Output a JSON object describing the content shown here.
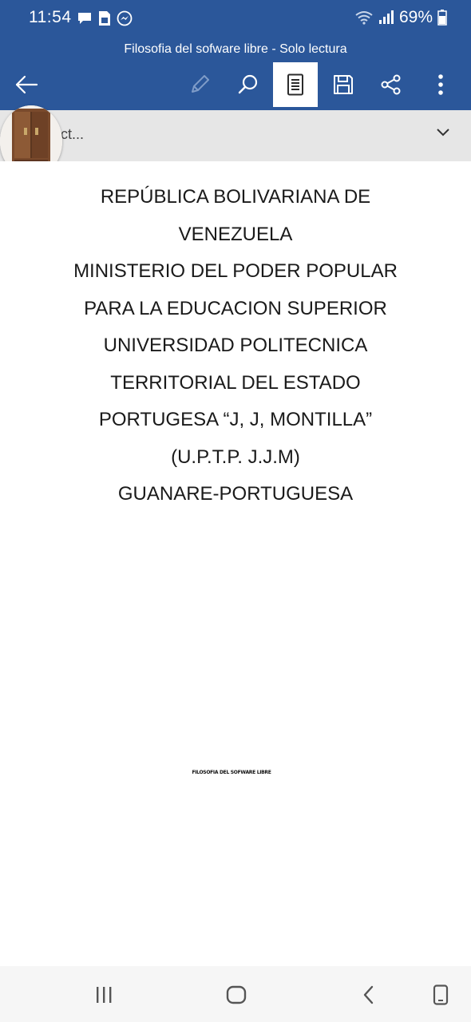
{
  "status_bar": {
    "time": "11:54",
    "battery": "69%",
    "icons_left": [
      "chat-bubble-icon",
      "sim-card-icon",
      "messenger-icon"
    ],
    "icons_right": [
      "wifi-icon",
      "signal-icon",
      "battery-icon"
    ]
  },
  "app": {
    "title": "Filosofia del sofware libre - Solo lectura",
    "brand_color": "#2b579a"
  },
  "toolbar": {
    "items": [
      {
        "name": "back-arrow-icon"
      },
      {
        "name": "edit-pencil-icon"
      },
      {
        "name": "search-icon"
      },
      {
        "name": "read-mode-icon",
        "active": true
      },
      {
        "name": "save-icon"
      },
      {
        "name": "share-icon"
      },
      {
        "name": "more-vert-icon"
      }
    ]
  },
  "banner": {
    "text": "ct..."
  },
  "document": {
    "lines": [
      "REPÚBLICA BOLIVARIANA DE",
      "VENEZUELA",
      "MINISTERIO DEL PODER POPULAR",
      "PARA LA EDUCACION SUPERIOR",
      "UNIVERSIDAD POLITECNICA",
      "TERRITORIAL DEL ESTADO",
      "PORTUGESA “J, J, MONTILLA”",
      "(U.P.T.P. J.J.M)",
      "GUANARE-PORTUGUESA"
    ],
    "footer": "FILOSOFIA DEL SOFWARE LIBRE"
  },
  "nav_bar": {
    "items": [
      "recents-icon",
      "home-icon",
      "back-icon",
      "screen-icon"
    ]
  }
}
